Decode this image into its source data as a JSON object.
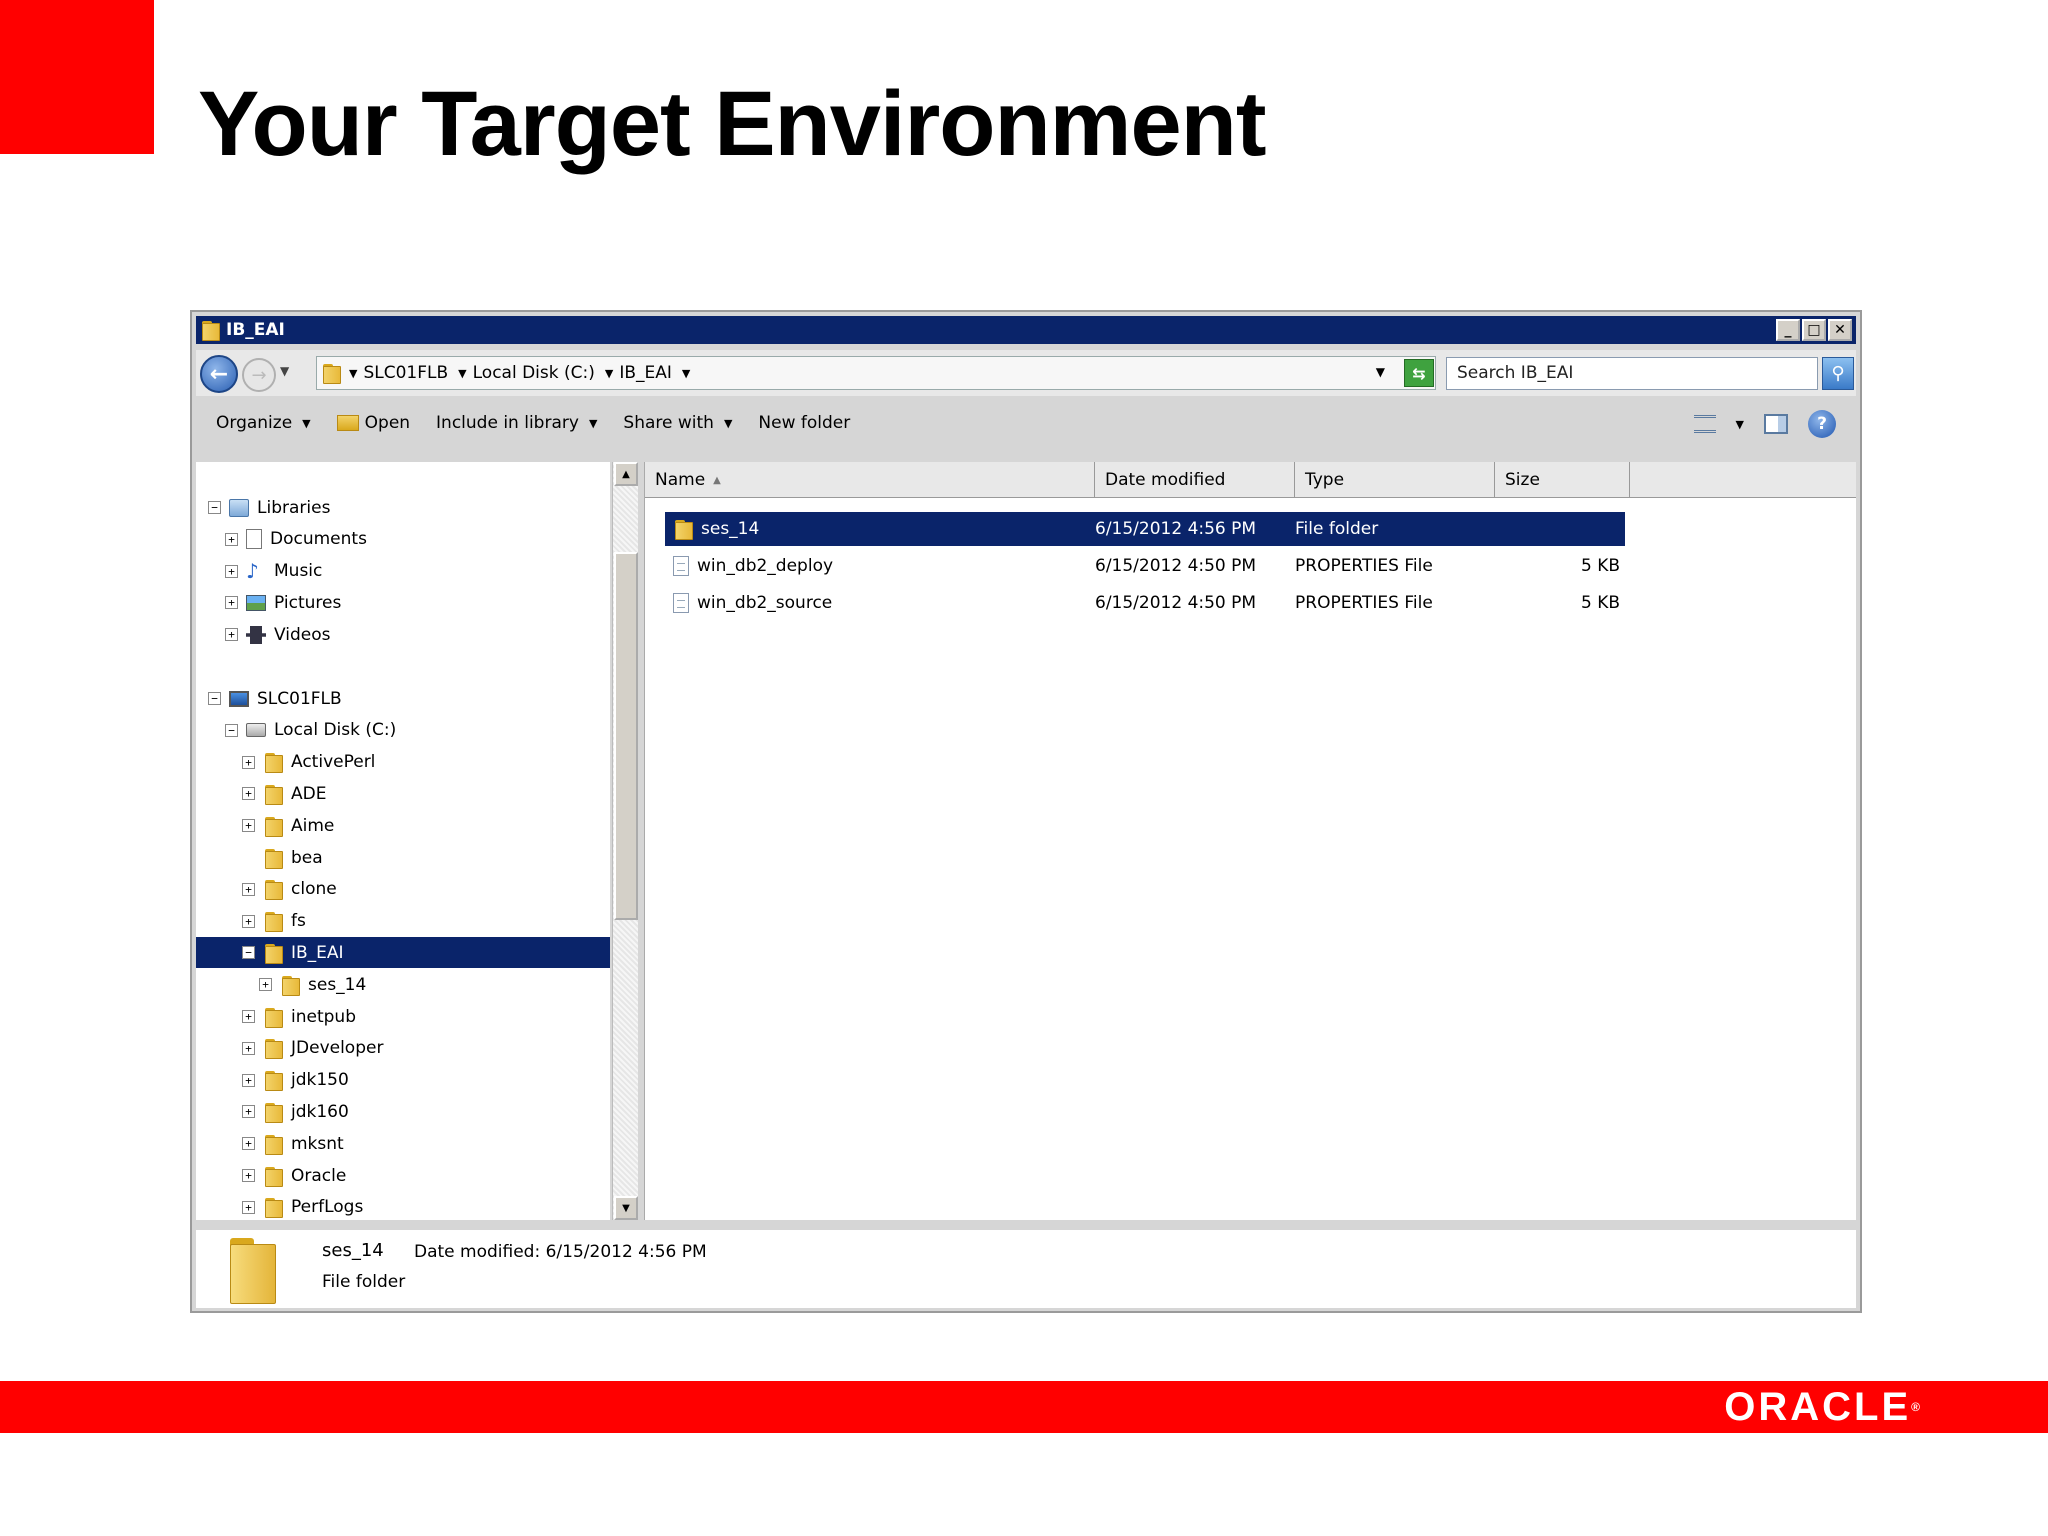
{
  "slide": {
    "title": "Your Target Environment",
    "brand": "ORACLE",
    "brand_mark": "®",
    "colors": {
      "accent": "#ff0000",
      "selection": "#0a246a"
    }
  },
  "window": {
    "title": "IB_EAI",
    "buttons": {
      "minimize": "_",
      "maximize": "□",
      "close": "✕"
    }
  },
  "address": {
    "breadcrumbs": [
      "SLC01FLB",
      "Local Disk (C:)",
      "IB_EAI"
    ],
    "search_placeholder": "Search IB_EAI"
  },
  "toolbar": {
    "organize": "Organize",
    "open": "Open",
    "include_in_library": "Include in library",
    "share_with": "Share with",
    "new_folder": "New folder"
  },
  "nav": {
    "items": [
      {
        "label": "Libraries",
        "level": 0,
        "expander": "−",
        "icon": "library-icon"
      },
      {
        "label": "Documents",
        "level": 1,
        "expander": "+",
        "icon": "documents-icon"
      },
      {
        "label": "Music",
        "level": 1,
        "expander": "+",
        "icon": "music-icon"
      },
      {
        "label": "Pictures",
        "level": 1,
        "expander": "+",
        "icon": "pictures-icon"
      },
      {
        "label": "Videos",
        "level": 1,
        "expander": "+",
        "icon": "videos-icon"
      },
      {
        "label": "SLC01FLB",
        "level": 0,
        "expander": "−",
        "icon": "computer-icon"
      },
      {
        "label": "Local Disk (C:)",
        "level": 1,
        "expander": "−",
        "icon": "disk-icon"
      },
      {
        "label": "ActivePerl",
        "level": 2,
        "expander": "+",
        "icon": "folder-icon"
      },
      {
        "label": "ADE",
        "level": 2,
        "expander": "+",
        "icon": "folder-icon"
      },
      {
        "label": "Aime",
        "level": 2,
        "expander": "+",
        "icon": "folder-icon"
      },
      {
        "label": "bea",
        "level": 2,
        "expander": "",
        "icon": "folder-icon"
      },
      {
        "label": "clone",
        "level": 2,
        "expander": "+",
        "icon": "folder-icon"
      },
      {
        "label": "fs",
        "level": 2,
        "expander": "+",
        "icon": "folder-icon"
      },
      {
        "label": "IB_EAI",
        "level": 2,
        "expander": "−",
        "icon": "folder-icon",
        "selected": true
      },
      {
        "label": "ses_14",
        "level": 3,
        "expander": "+",
        "icon": "folder-icon"
      },
      {
        "label": "inetpub",
        "level": 2,
        "expander": "+",
        "icon": "folder-icon"
      },
      {
        "label": "JDeveloper",
        "level": 2,
        "expander": "+",
        "icon": "folder-icon"
      },
      {
        "label": "jdk150",
        "level": 2,
        "expander": "+",
        "icon": "folder-icon"
      },
      {
        "label": "jdk160",
        "level": 2,
        "expander": "+",
        "icon": "folder-icon"
      },
      {
        "label": "mksnt",
        "level": 2,
        "expander": "+",
        "icon": "folder-icon"
      },
      {
        "label": "Oracle",
        "level": 2,
        "expander": "+",
        "icon": "folder-icon"
      },
      {
        "label": "PerfLogs",
        "level": 2,
        "expander": "+",
        "icon": "folder-icon"
      }
    ]
  },
  "columns": {
    "name": "Name",
    "date": "Date modified",
    "type": "Type",
    "size": "Size"
  },
  "files": [
    {
      "name": "ses_14",
      "date": "6/15/2012 4:56 PM",
      "type": "File folder",
      "size": "",
      "icon": "folder-icon",
      "selected": true
    },
    {
      "name": "win_db2_deploy",
      "date": "6/15/2012 4:50 PM",
      "type": "PROPERTIES File",
      "size": "5 KB",
      "icon": "file-icon"
    },
    {
      "name": "win_db2_source",
      "date": "6/15/2012 4:50 PM",
      "type": "PROPERTIES File",
      "size": "5 KB",
      "icon": "file-icon"
    }
  ],
  "details": {
    "name": "ses_14",
    "date_label": "Date modified:",
    "date_value": "6/15/2012 4:56 PM",
    "type": "File folder"
  }
}
